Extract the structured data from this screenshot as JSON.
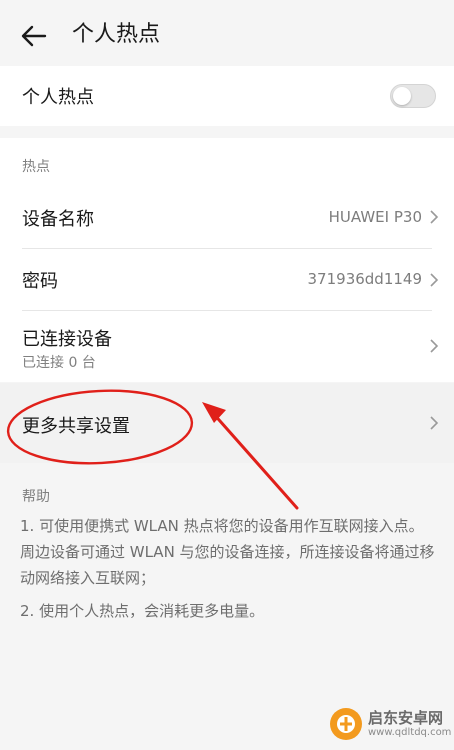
{
  "appbar": {
    "title": "个人热点"
  },
  "hotspot_toggle": {
    "label": "个人热点",
    "enabled": false
  },
  "hotspot_section": {
    "header": "热点",
    "device_name": {
      "label": "设备名称",
      "value": "HUAWEI P30"
    },
    "password": {
      "label": "密码",
      "value": "371936dd1149"
    },
    "connected_devices": {
      "label": "已连接设备",
      "sub": "已连接 0 台"
    }
  },
  "more_settings": {
    "label": "更多共享设置"
  },
  "help": {
    "header": "帮助",
    "items": [
      "1. 可使用便携式 WLAN 热点将您的设备用作互联网接入点。周边设备可通过 WLAN 与您的设备连接，所连接设备将通过移动网络接入互联网；",
      "2. 使用个人热点，会消耗更多电量。"
    ]
  },
  "annotation": {
    "color": "#e0201a"
  },
  "watermark": {
    "title": "启东安卓网",
    "url": "www.qdltdq.com"
  },
  "colors": {
    "background": "#f5f5f5",
    "card": "#ffffff",
    "secondary_text": "#808080"
  }
}
